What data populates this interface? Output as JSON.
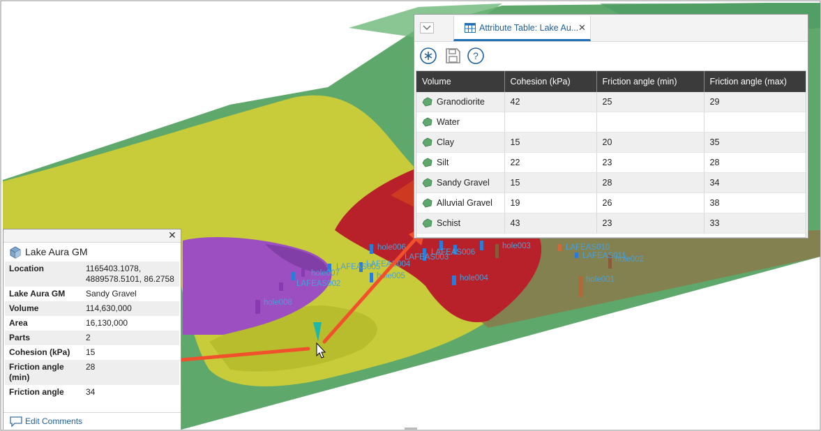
{
  "attribute_table": {
    "tab_title": "Attribute Table: Lake Au...",
    "columns": [
      "Volume",
      "Cohesion (kPa)",
      "Friction angle (min)",
      "Friction angle (max)"
    ],
    "rows": [
      {
        "volume": "Granodiorite",
        "cohesion": "42",
        "fmin": "25",
        "fmax": "29"
      },
      {
        "volume": "Water",
        "cohesion": "",
        "fmin": "",
        "fmax": ""
      },
      {
        "volume": "Clay",
        "cohesion": "15",
        "fmin": "20",
        "fmax": "35"
      },
      {
        "volume": "Silt",
        "cohesion": "22",
        "fmin": "23",
        "fmax": "28"
      },
      {
        "volume": "Sandy Gravel",
        "cohesion": "15",
        "fmin": "28",
        "fmax": "34"
      },
      {
        "volume": "Alluvial Gravel",
        "cohesion": "19",
        "fmin": "26",
        "fmax": "38"
      },
      {
        "volume": "Schist",
        "cohesion": "43",
        "fmin": "23",
        "fmax": "33"
      }
    ],
    "toolbar_icons": [
      "asterisk-icon",
      "save-icon",
      "help-icon"
    ]
  },
  "properties": {
    "title": "Lake Aura GM",
    "rows": [
      {
        "key": "Location",
        "value": "1165403.1078, 4889578.5101, 86.2758"
      },
      {
        "key": "Lake Aura GM",
        "value": "Sandy Gravel"
      },
      {
        "key": "Volume",
        "value": "114,630,000"
      },
      {
        "key": "Area",
        "value": "16,130,000"
      },
      {
        "key": "Parts",
        "value": "2"
      },
      {
        "key": "Cohesion (kPa)",
        "value": "15"
      },
      {
        "key": "Friction angle (min)",
        "value": "28"
      },
      {
        "key": "Friction angle",
        "value": "34"
      }
    ],
    "footer_link": "Edit Comments"
  },
  "scene": {
    "well_labels": [
      "hole006",
      "LAFEAS005",
      "LAFEAS004",
      "LAFEAS006",
      "hole003",
      "LAFEAS010",
      "LAFEAS011",
      "hole002",
      "hole001",
      "hole004",
      "hole005",
      "hole007",
      "LAFEAS002",
      "LAFEAS003",
      "hole008"
    ],
    "colors": {
      "green_terrain": "#5fa86c",
      "yellow_gravel": "#c8cc3a",
      "red_volume": "#b8202a",
      "purple_volume": "#9b4fc0",
      "brown_volume": "#8a7a4a",
      "arrow": "#f0502c",
      "accent": "#1f6fb5"
    }
  }
}
